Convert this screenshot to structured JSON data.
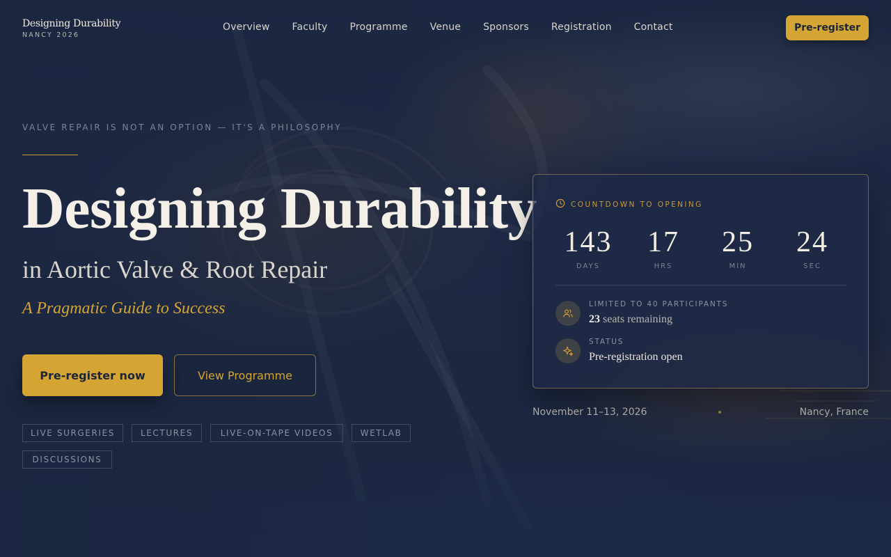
{
  "brand": {
    "name": "Designing Durability",
    "subtitle": "NANCY 2026"
  },
  "nav": {
    "items": [
      "Overview",
      "Faculty",
      "Programme",
      "Venue",
      "Sponsors",
      "Registration",
      "Contact"
    ]
  },
  "header": {
    "cta_label": "Pre-register"
  },
  "hero": {
    "tagline": "VALVE REPAIR IS NOT AN OPTION — IT'S A PHILOSOPHY",
    "title": "Designing Durability",
    "subtitle": "in Aortic Valve & Root Repair",
    "guide": "A Pragmatic Guide to Success",
    "primary_cta": "Pre-register now",
    "secondary_cta": "View Programme",
    "tags": [
      "LIVE SURGERIES",
      "LECTURES",
      "LIVE-ON-TAPE VIDEOS",
      "WETLAB",
      "DISCUSSIONS"
    ]
  },
  "countdown": {
    "label": "COUNTDOWN TO OPENING",
    "units": [
      {
        "value": "143",
        "unit": "DAYS"
      },
      {
        "value": "17",
        "unit": "HRS"
      },
      {
        "value": "25",
        "unit": "MIN"
      },
      {
        "value": "24",
        "unit": "SEC"
      }
    ],
    "participants_label": "LIMITED TO 40 PARTICIPANTS",
    "seats_number": "23",
    "seats_text": "seats remaining",
    "status_label": "STATUS",
    "status_value": "Pre-registration open"
  },
  "event": {
    "dates": "November 11–13, 2026",
    "location": "Nancy, France"
  },
  "colors": {
    "accent": "#d4a533",
    "background": "#1b2742",
    "text": "#f4f0e7"
  },
  "icons": {
    "countdown": "clock-icon",
    "participants": "users-icon",
    "status": "sparkle-icon"
  }
}
